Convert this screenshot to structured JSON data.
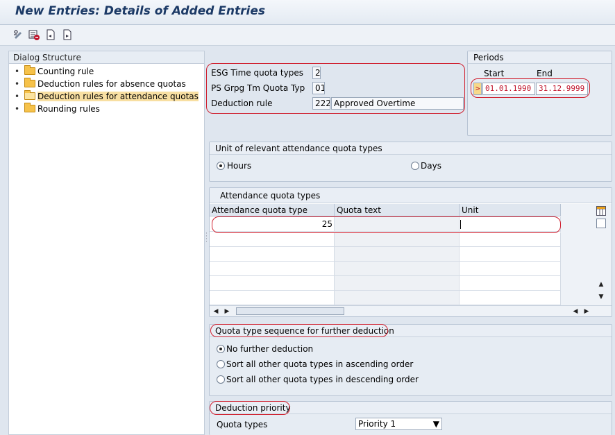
{
  "title": "New Entries: Details of Added Entries",
  "toolbar": {
    "icons": [
      "display-change-icon",
      "delete-icon",
      "previous-entry-icon",
      "next-entry-icon"
    ]
  },
  "dialog_structure": {
    "header": "Dialog Structure",
    "items": [
      {
        "label": "Counting rule",
        "selected": false
      },
      {
        "label": "Deduction rules for absence quotas",
        "selected": false
      },
      {
        "label": "Deduction rules for attendance quotas",
        "selected": true
      },
      {
        "label": "Rounding rules",
        "selected": false
      }
    ]
  },
  "header_fields": {
    "esg_label": "ESG Time quota types",
    "esg_value": "2",
    "psgrpg_label": "PS Grpg Tm Quota Typ",
    "psgrpg_value": "01",
    "deduction_rule_label": "Deduction rule",
    "deduction_rule_value": "222",
    "deduction_rule_text": "Approved Overtime"
  },
  "periods": {
    "title": "Periods",
    "start_label": "Start",
    "end_label": "End",
    "start_value": "01.01.1990",
    "end_value": "31.12.9999",
    "arrow": ">"
  },
  "unit_group": {
    "title": "Unit of relevant attendance quota types",
    "hours_label": "Hours",
    "days_label": "Days",
    "selected": "hours"
  },
  "attendance_table": {
    "title": "Attendance quota types",
    "columns": [
      "Attendance quota type",
      "Quota text",
      "Unit"
    ],
    "rows": [
      {
        "type": "25",
        "text": "",
        "unit": ""
      }
    ]
  },
  "sequence_group": {
    "title": "Quota type sequence for further deduction",
    "options": [
      "No further deduction",
      "Sort all other quota types in ascending order",
      "Sort all other quota types in descending order"
    ],
    "selected_index": 0
  },
  "priority_group": {
    "title": "Deduction priority",
    "quota_types_label": "Quota types",
    "priority_value": "Priority 1"
  },
  "colors": {
    "accent": "#1c3a66",
    "highlight_ring": "#d0202f",
    "selected_tree": "#f8dfa2"
  }
}
